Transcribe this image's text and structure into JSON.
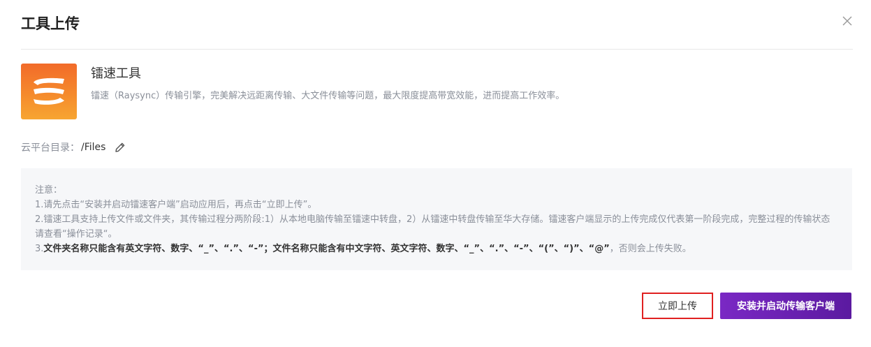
{
  "dialog": {
    "title": "工具上传"
  },
  "tool": {
    "name": "镭速工具",
    "description": "镭速（Raysync）传输引擎，完美解决远距离传输、大文件传输等问题，最大限度提高带宽效能，进而提高工作效率。"
  },
  "directory": {
    "label": "云平台目录：",
    "value": "/Files"
  },
  "notice": {
    "heading": "注意：",
    "line1": "1.请先点击“安装并启动镭速客户端”启动应用后，再点击“立即上传”。",
    "line2a": "2.镭速工具支持上传文件或文件夹，其传输过程分两阶段:1）从本地电脑传输至镭速中转盘，2）从镭速中转盘传输至华大存储。镭速客户端显示的上传完成仅代表第一阶段完成，完整过程的传输状态请查看“操作记录“。",
    "line3_prefix": "3.",
    "line3_bold": "文件夹名称只能含有英文字符、数字、“_”、“.”、“-”；文件名称只能含有中文字符、英文字符、数字、“_”、“.”、“-”、“(”、“)”、“@”",
    "line3_suffix": "，否则会上传失败。"
  },
  "buttons": {
    "upload_now": "立即上传",
    "install_start": "安装并启动传输客户端"
  },
  "colors": {
    "accent_purple": "#6a22b2",
    "highlight_red": "#e02020",
    "logo_orange": "#f26b2a"
  }
}
